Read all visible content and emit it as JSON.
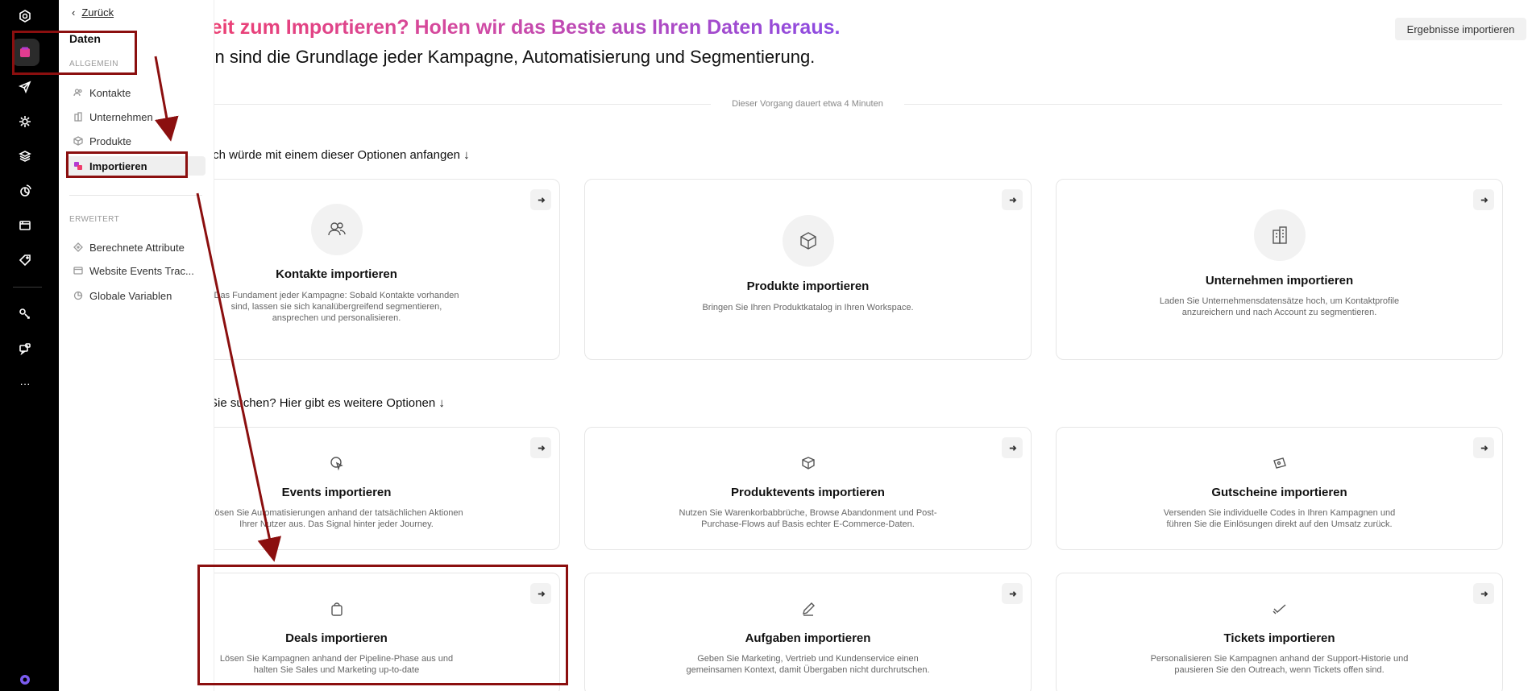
{
  "sidebar": {
    "back_label": "Zurück",
    "title": "Daten",
    "section_general": "ALLGEMEIN",
    "section_advanced": "ERWEITERT",
    "items_general": [
      {
        "label": "Kontakte",
        "icon": "users-icon"
      },
      {
        "label": "Unternehmen",
        "icon": "building-icon"
      },
      {
        "label": "Produkte",
        "icon": "box-icon"
      },
      {
        "label": "Importieren",
        "icon": "import-icon"
      }
    ],
    "items_advanced": [
      {
        "label": "Berechnete Attribute",
        "icon": "formula-icon"
      },
      {
        "label": "Website Events Trac...",
        "icon": "browser-icon"
      },
      {
        "label": "Globale Variablen",
        "icon": "variable-icon"
      }
    ]
  },
  "header": {
    "headline": "Bereit zum Importieren? Holen wir das Beste aus Ihren Daten heraus.",
    "subhead": "Daten sind die Grundlage jeder Kampagne, Automatisierung und Segmentierung.",
    "import_results_button": "Ergebnisse importieren",
    "duration_note": "Dieser Vorgang dauert etwa 4 Minuten"
  },
  "section_primary": "Ich würde mit einem dieser Optionen anfangen ↓",
  "section_more": "Sie suchen? Hier gibt es weitere Optionen ↓",
  "primary_cards": [
    {
      "title": "Kontakte importieren",
      "icon": "contacts-icon",
      "desc": "Das Fundament jeder Kampagne: Sobald Kontakte vorhanden sind, lassen sie sich kanalübergreifend segmentieren, ansprechen und personalisieren."
    },
    {
      "title": "Produkte importieren",
      "icon": "package-icon",
      "desc": "Bringen Sie Ihren Produktkatalog in Ihren Workspace."
    },
    {
      "title": "Unternehmen importieren",
      "icon": "company-icon",
      "desc": "Laden Sie Unternehmensdatensätze hoch, um Kontaktprofile anzureichern und nach Account zu segmentieren."
    }
  ],
  "more_cards": [
    {
      "title": "Events importieren",
      "icon": "cursor-click-icon",
      "desc": "Lösen Sie Automatisierungen anhand der tatsächlichen Aktionen Ihrer Nutzer aus. Das Signal hinter jeder Journey."
    },
    {
      "title": "Produktevents importieren",
      "icon": "boxes-icon",
      "desc": "Nutzen Sie Warenkorbabbrüche, Browse Abandonment und Post-Purchase-Flows auf Basis echter E-Commerce-Daten."
    },
    {
      "title": "Gutscheine importieren",
      "icon": "coupon-icon",
      "desc": "Versenden Sie individuelle Codes in Ihren Kampagnen und führen Sie die Einlösungen direkt auf den Umsatz zurück."
    },
    {
      "title": "Deals importieren",
      "icon": "deal-bag-icon",
      "desc": "Lösen Sie Kampagnen anhand der Pipeline-Phase aus und halten Sie Sales und Marketing up-to-date"
    },
    {
      "title": "Aufgaben importieren",
      "icon": "task-pen-icon",
      "desc": "Geben Sie Marketing, Vertrieb und Kundenservice einen gemeinsamen Kontext, damit Übergaben nicht durchrutschen."
    },
    {
      "title": "Tickets importieren",
      "icon": "ticket-check-icon",
      "desc": "Personalisieren Sie Kampagnen anhand der Support-Historie und pausieren Sie den Outreach, wenn Tickets offen sind."
    }
  ],
  "rail_icons": [
    "logo-icon",
    "data-icon",
    "send-icon",
    "automation-icon",
    "layers-icon",
    "analytics-icon",
    "template-icon",
    "tag-icon",
    "integration-icon",
    "chat-icon",
    "more-icon",
    "profile-icon"
  ],
  "colors": {
    "annotation": "#8b0f0f",
    "gradient_start": "#ef3e6d",
    "gradient_end": "#8b4be3"
  }
}
